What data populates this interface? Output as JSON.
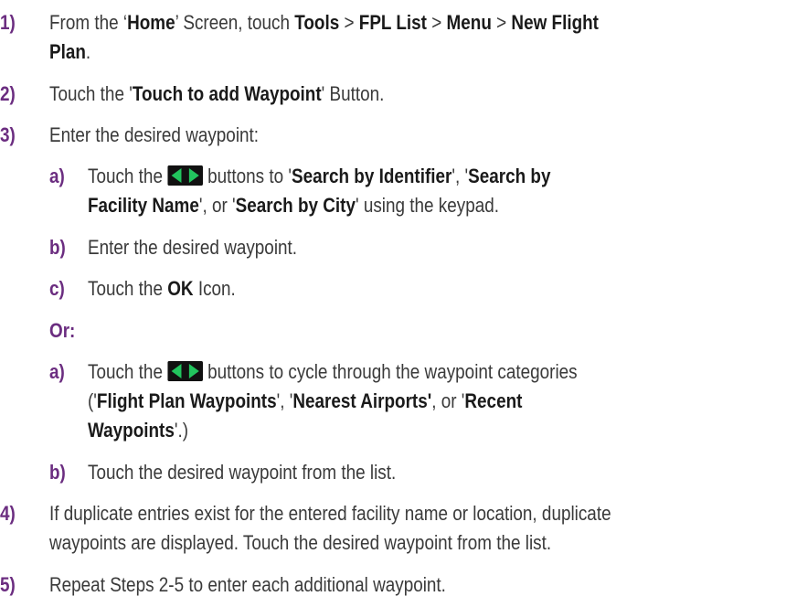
{
  "steps": [
    {
      "num": "1)",
      "lines": [
        [
          {
            "t": "From the ‘",
            "b": false
          },
          {
            "t": "Home",
            "b": true
          },
          {
            "t": "’ Screen, touch ",
            "b": false
          },
          {
            "t": "Tools",
            "b": true
          },
          {
            "t": " > ",
            "b": false
          },
          {
            "t": "FPL List",
            "b": true
          },
          {
            "t": " > ",
            "b": false
          },
          {
            "t": "Menu",
            "b": true
          },
          {
            "t": " > ",
            "b": false
          },
          {
            "t": "New Flight",
            "b": true
          }
        ],
        [
          {
            "t": "Plan",
            "b": true
          },
          {
            "t": ".",
            "b": false
          }
        ]
      ]
    },
    {
      "num": "2)",
      "lines": [
        [
          {
            "t": "Touch the '",
            "b": false
          },
          {
            "t": "Touch to add Waypoint",
            "b": true
          },
          {
            "t": "' Button.",
            "b": false
          }
        ]
      ]
    },
    {
      "num": "3)",
      "lines": [
        [
          {
            "t": "Enter the desired waypoint:",
            "b": false
          }
        ]
      ]
    },
    {
      "num": "4)",
      "lines": [
        [
          {
            "t": "If duplicate entries exist for the entered facility name or location, duplicate",
            "b": false
          }
        ],
        [
          {
            "t": "waypoints are displayed.  Touch the desired waypoint from the list.",
            "b": false
          }
        ]
      ]
    },
    {
      "num": "5)",
      "lines": [
        [
          {
            "t": "Repeat Steps 2-5 to enter each additional waypoint.",
            "b": false
          }
        ]
      ]
    }
  ],
  "substeps_a": [
    {
      "num": "a)",
      "lines": [
        [
          {
            "t": "Touch the ",
            "b": false
          },
          {
            "icon": "arrows"
          },
          {
            "t": " buttons to '",
            "b": false
          },
          {
            "t": "Search by Identifier",
            "b": true
          },
          {
            "t": "', '",
            "b": false
          },
          {
            "t": "Search by",
            "b": true
          }
        ],
        [
          {
            "t": "Facility Name",
            "b": true
          },
          {
            "t": "', or '",
            "b": false
          },
          {
            "t": "Search by City",
            "b": true
          },
          {
            "t": "' using the keypad.",
            "b": false
          }
        ]
      ]
    },
    {
      "num": "b)",
      "lines": [
        [
          {
            "t": "Enter the desired waypoint.",
            "b": false
          }
        ]
      ]
    },
    {
      "num": "c)",
      "lines": [
        [
          {
            "t": "Touch the ",
            "b": false
          },
          {
            "t": "OK",
            "b": true
          },
          {
            "t": " Icon.",
            "b": false
          }
        ]
      ]
    }
  ],
  "or_label": "Or:",
  "substeps_b": [
    {
      "num": "a)",
      "lines": [
        [
          {
            "t": "Touch the ",
            "b": false
          },
          {
            "icon": "arrows"
          },
          {
            "t": " buttons to cycle through the waypoint categories",
            "b": false
          }
        ],
        [
          {
            "t": "('",
            "b": false
          },
          {
            "t": "Flight Plan Waypoints",
            "b": true
          },
          {
            "t": "', '",
            "b": false
          },
          {
            "t": "Nearest Airports'",
            "b": true
          },
          {
            "t": ", or '",
            "b": false
          },
          {
            "t": "Recent",
            "b": true
          }
        ],
        [
          {
            "t": "Waypoints",
            "b": true
          },
          {
            "t": "'.)",
            "b": false
          }
        ]
      ]
    },
    {
      "num": "b)",
      "lines": [
        [
          {
            "t": "Touch the desired waypoint from the list.",
            "b": false
          }
        ]
      ]
    }
  ],
  "colors": {
    "number": "#6b2d80",
    "text": "#3a3a3a",
    "bold": "#1a1a1a",
    "arrow": "#22c55e"
  },
  "icons": {
    "arrows": "left-right-arrow-buttons-icon"
  }
}
